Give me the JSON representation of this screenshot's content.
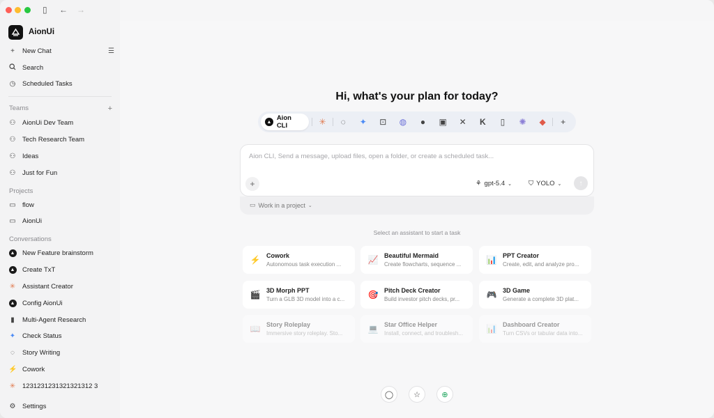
{
  "app": {
    "name": "AionUi"
  },
  "sidebar": {
    "new_chat": "New Chat",
    "search": "Search",
    "scheduled": "Scheduled Tasks",
    "teams_title": "Teams",
    "teams": [
      "AionUi Dev Team",
      "Tech Research Team",
      "Ideas",
      "Just for Fun"
    ],
    "projects_title": "Projects",
    "projects": [
      "flow",
      "AionUi"
    ],
    "conversations_title": "Conversations",
    "conversations": [
      {
        "label": "New Feature brainstorm",
        "icon": "aion-icon"
      },
      {
        "label": "Create TxT",
        "icon": "aion-icon"
      },
      {
        "label": "Assistant Creator",
        "icon": "claude-icon"
      },
      {
        "label": "Config AionUi",
        "icon": "aion-icon"
      },
      {
        "label": "Multi-Agent Research",
        "icon": "doc-icon"
      },
      {
        "label": "Check Status",
        "icon": "sparkle-icon"
      },
      {
        "label": "Story Writing",
        "icon": "chat-icon"
      },
      {
        "label": "Cowork",
        "icon": "bolt-icon"
      },
      {
        "label": "1231231231321321312 3",
        "icon": "claude-icon"
      }
    ],
    "settings": "Settings"
  },
  "main": {
    "headline": "Hi, what's your plan for today?",
    "active_agent": "Aion CLI",
    "composer_placeholder": "Aion CLI, Send a message, upload files, open a folder, or create a scheduled task...",
    "model": "gpt-5.4",
    "mode": "YOLO",
    "project_link": "Work in a project",
    "assist_hint": "Select an assistant to start a task",
    "cards": [
      {
        "title": "Cowork",
        "desc": "Autonomous task execution ...",
        "icon": "⚡",
        "color": "#e8653a"
      },
      {
        "title": "Beautiful Mermaid",
        "desc": "Create flowcharts, sequence ...",
        "icon": "📈",
        "color": "#4a7bd6"
      },
      {
        "title": "PPT Creator",
        "desc": "Create, edit, and analyze pro...",
        "icon": "📊",
        "color": "#3b6fd8"
      },
      {
        "title": "3D Morph PPT",
        "desc": "Turn a GLB 3D model into a c...",
        "icon": "🎬",
        "color": "#333"
      },
      {
        "title": "Pitch Deck Creator",
        "desc": "Build investor pitch decks, pr...",
        "icon": "🎯",
        "color": "#d23"
      },
      {
        "title": "3D Game",
        "desc": "Generate a complete 3D plat...",
        "icon": "🎮",
        "color": "#333"
      },
      {
        "title": "Story Roleplay",
        "desc": "Immersive story roleplay. Sto...",
        "icon": "📖",
        "color": "#999"
      },
      {
        "title": "Star Office Helper",
        "desc": "Install, connect, and troublesh...",
        "icon": "💻",
        "color": "#999"
      },
      {
        "title": "Dashboard Creator",
        "desc": "Turn CSVs or tabular data into...",
        "icon": "📊",
        "color": "#999"
      }
    ]
  }
}
